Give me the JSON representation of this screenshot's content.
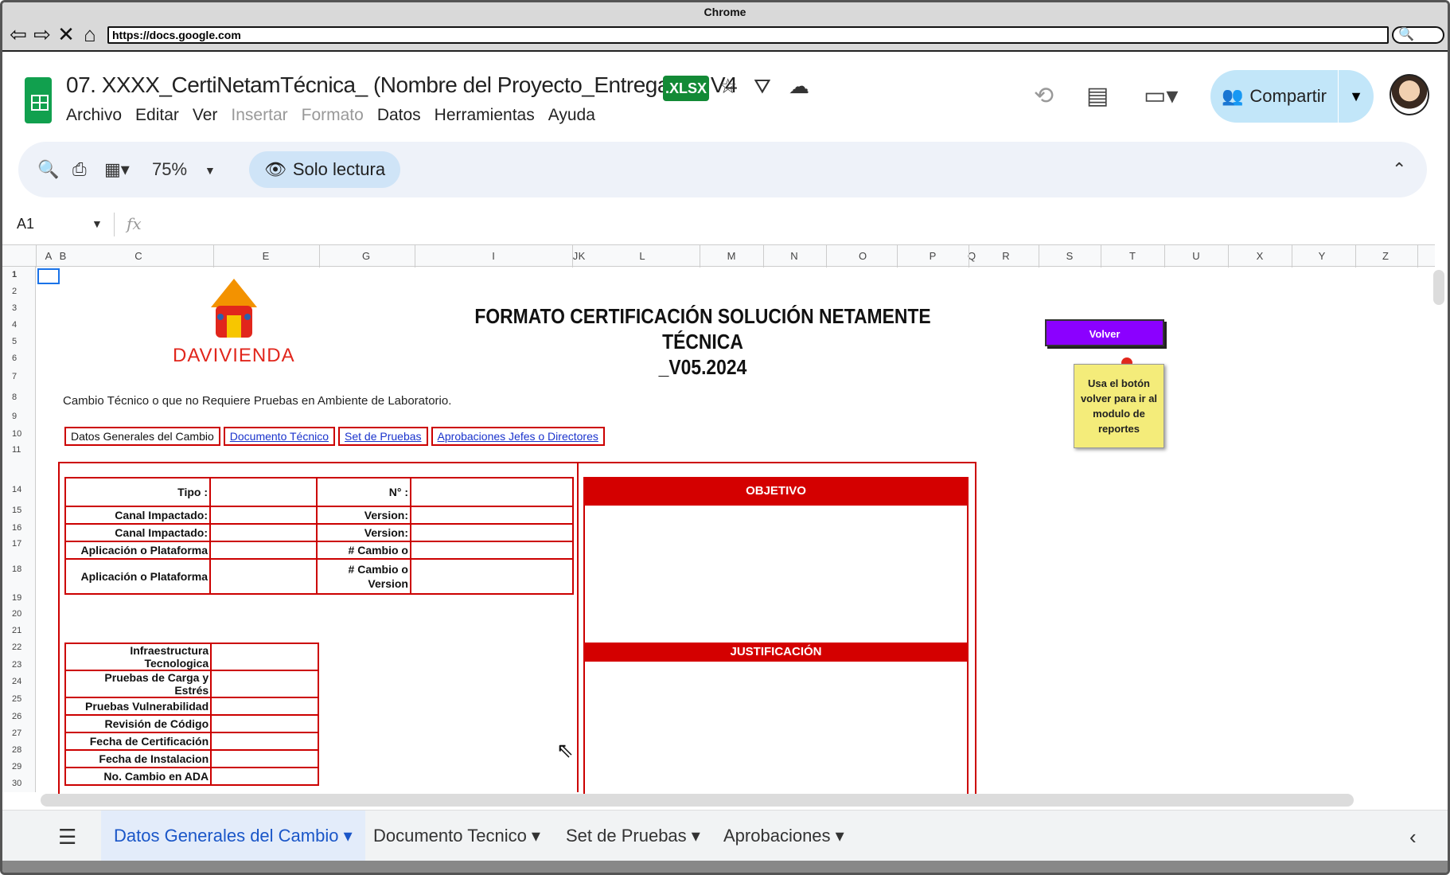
{
  "browser": {
    "title": "Chrome",
    "url": "https://docs.google.com",
    "nav_icons": [
      "back-arrow-icon",
      "forward-arrow-icon",
      "close-x-icon",
      "home-icon"
    ]
  },
  "doc": {
    "title": "07. XXXX_CertiNetamTécnica_ (Nombre del Proyecto_Entregable) V4",
    "badge": ".XLSX",
    "menu": [
      "Archivo",
      "Editar",
      "Ver",
      "Insertar",
      "Formato",
      "Datos",
      "Herramientas",
      "Ayuda"
    ],
    "share_label": "Compartir"
  },
  "toolbar": {
    "zoom": "75%",
    "readonly_label": "Solo lectura"
  },
  "formula_bar": {
    "cell_ref": "A1",
    "fx": "fx"
  },
  "columns": [
    "A",
    "B",
    "C",
    "E",
    "G",
    "I",
    "J",
    "K",
    "L",
    "M",
    "N",
    "O",
    "P",
    "Q",
    "R",
    "S",
    "T",
    "U",
    "X",
    "Y",
    "Z"
  ],
  "rows": [
    "1",
    "2",
    "3",
    "4",
    "5",
    "6",
    "7",
    "8",
    "9",
    "10",
    "11",
    "14",
    "15",
    "16",
    "17",
    "18",
    "19",
    "20",
    "21",
    "22",
    "23",
    "24",
    "25",
    "26",
    "27",
    "28",
    "29",
    "30"
  ],
  "sheet": {
    "brand": "DAVIVIENDA",
    "title_line1": "FORMATO CERTIFICACIÓN SOLUCIÓN NETAMENTE TÉCNICA",
    "title_line2": "_V05.2024",
    "volver": "Volver",
    "note": "Usa el botón volver para ir al modulo de reportes",
    "subtitle": "Cambio Técnico o que no Requiere Pruebas en Ambiente de Laboratorio.",
    "tabs": [
      "Datos Generales del Cambio",
      "Documento Técnico",
      "Set de Pruebas",
      "Aprobaciones Jefes o Directores"
    ],
    "form1": {
      "tipo": "Tipo :",
      "numero": "N° :",
      "canal1": "Canal Impactado:",
      "version1": "Version:",
      "canal2": "Canal Impactado:",
      "version2": "Version:",
      "app1": "Aplicación o Plataforma",
      "cambio1": "# Cambio o",
      "app2": "Aplicación o Plataforma",
      "cambio2": "# Cambio o Version"
    },
    "form2": [
      "Infraestructura Tecnologica",
      "Pruebas de Carga y Estrés",
      "Pruebas Vulnerabilidad",
      "Revisión de Código",
      "Fecha de Certificación",
      "Fecha de Instalacion",
      "No. Cambio en ADA"
    ],
    "objetivo": "OBJETIVO",
    "justificacion": "JUSTIFICACIÓN"
  },
  "bottom_tabs": [
    "Datos Generales del Cambio",
    "Documento Tecnico",
    "Set de Pruebas",
    "Aprobaciones"
  ],
  "colors": {
    "accent_red": "#d40000",
    "sheets_green": "#11a04e",
    "volver_purple": "#8b00ff",
    "active_tab_blue": "#1a56c8"
  }
}
